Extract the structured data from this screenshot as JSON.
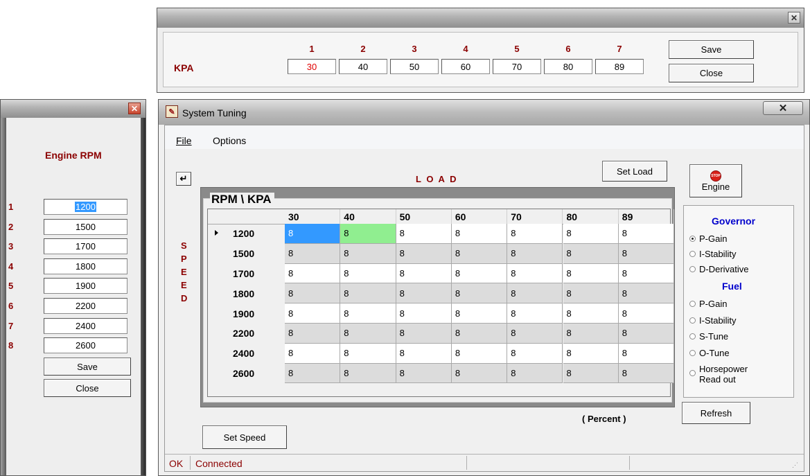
{
  "kpa_window": {
    "label": "KPA",
    "columns": [
      "1",
      "2",
      "3",
      "4",
      "5",
      "6",
      "7"
    ],
    "values": [
      "30",
      "40",
      "50",
      "60",
      "70",
      "80",
      "89"
    ],
    "save_label": "Save",
    "close_label": "Close"
  },
  "rpm_window": {
    "title": "Engine RPM",
    "rows": [
      "1",
      "2",
      "3",
      "4",
      "5",
      "6",
      "7",
      "8"
    ],
    "values": [
      "1200",
      "1500",
      "1700",
      "1800",
      "1900",
      "2200",
      "2400",
      "2600"
    ],
    "save_label": "Save",
    "close_label": "Close"
  },
  "main_window": {
    "title": "System Tuning",
    "menu": {
      "file": "File",
      "options": "Options"
    },
    "set_load_label": "Set Load",
    "load_label": "L O A D",
    "speed_letters": [
      "S",
      "P",
      "E",
      "E",
      "D"
    ],
    "engine_button": {
      "stop_text": "STOP",
      "label": "Engine"
    },
    "grid": {
      "caption": "RPM \\ KPA",
      "columns": [
        "30",
        "40",
        "50",
        "60",
        "70",
        "80",
        "89"
      ],
      "rows": [
        {
          "rpm": "1200",
          "cells": [
            "8",
            "8",
            "8",
            "8",
            "8",
            "8",
            "8"
          ]
        },
        {
          "rpm": "1500",
          "cells": [
            "8",
            "8",
            "8",
            "8",
            "8",
            "8",
            "8"
          ]
        },
        {
          "rpm": "1700",
          "cells": [
            "8",
            "8",
            "8",
            "8",
            "8",
            "8",
            "8"
          ]
        },
        {
          "rpm": "1800",
          "cells": [
            "8",
            "8",
            "8",
            "8",
            "8",
            "8",
            "8"
          ]
        },
        {
          "rpm": "1900",
          "cells": [
            "8",
            "8",
            "8",
            "8",
            "8",
            "8",
            "8"
          ]
        },
        {
          "rpm": "2200",
          "cells": [
            "8",
            "8",
            "8",
            "8",
            "8",
            "8",
            "8"
          ]
        },
        {
          "rpm": "2400",
          "cells": [
            "8",
            "8",
            "8",
            "8",
            "8",
            "8",
            "8"
          ]
        },
        {
          "rpm": "2600",
          "cells": [
            "8",
            "8",
            "8",
            "8",
            "8",
            "8",
            "8"
          ]
        }
      ]
    },
    "governor": {
      "title": "Governor",
      "options": [
        "P-Gain",
        "I-Stability",
        "D-Derivative"
      ],
      "selected": "P-Gain"
    },
    "fuel": {
      "title": "Fuel",
      "options": [
        "P-Gain",
        "I-Stability",
        "S-Tune",
        "O-Tune",
        "Horsepower\nRead out"
      ]
    },
    "percent_label": "( Percent )",
    "refresh_label": "Refresh",
    "set_speed_label": "Set Speed",
    "status": {
      "ok": "OK",
      "connected": "Connected"
    },
    "colors": {
      "selected_cell": "#3399ff",
      "edit_cell": "#90ee90",
      "accent_blue": "#0000cc",
      "label_red": "#8b0000"
    }
  }
}
